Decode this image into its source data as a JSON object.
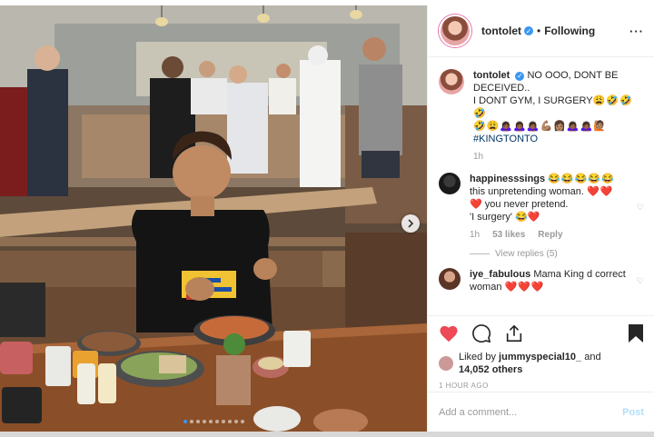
{
  "post": {
    "username": "tontolet",
    "follow_status": "Following",
    "more_icon": "more-options-icon",
    "verified_icon": "verified-badge-icon"
  },
  "caption": {
    "username": "tontolet",
    "line1": "NO OOO, DONT BE DECEIVED..",
    "line2": "I DONT GYM, I SURGERY",
    "emojis_line2": "😩🤣🤣🤣",
    "emojis_line3": "🤣😩🙇🏾‍♀️🙇🏾‍♀️🙇🏾‍♀️💪🏽👩🏽🙇🏾‍♀️🙇🏾‍♀️🙋🏽",
    "hashtag": "#KINGTONTO",
    "time": "1h"
  },
  "comments": [
    {
      "username": "happinesssings",
      "emojis": "😂😂😂😂😂",
      "text": "this unpretending woman.",
      "text_emojis": "❤️❤️",
      "line3": "you never pretend.",
      "line3_emoji": "❤️",
      "line4": "'I surgery'",
      "line4_emojis": "😂❤️",
      "time": "1h",
      "likes": "53 likes",
      "reply": "Reply",
      "view_replies": "View replies (5)"
    },
    {
      "username": "iye_fabulous",
      "text": "Mama King d correct woman",
      "emojis": "❤️❤️❤️"
    }
  ],
  "likes": {
    "prefix": "Liked by",
    "user": "jummyspecial10_",
    "and": "and",
    "others": "14,052 others"
  },
  "timestamp": "1 HOUR AGO",
  "comment_input": {
    "placeholder": "Add a comment...",
    "post_label": "Post"
  },
  "carousel": {
    "total_dots": 10,
    "active_index": 0
  },
  "colors": {
    "accent_blue": "#3897f0",
    "heart_red": "#ed4956",
    "post_disabled": "#b2dffc"
  }
}
